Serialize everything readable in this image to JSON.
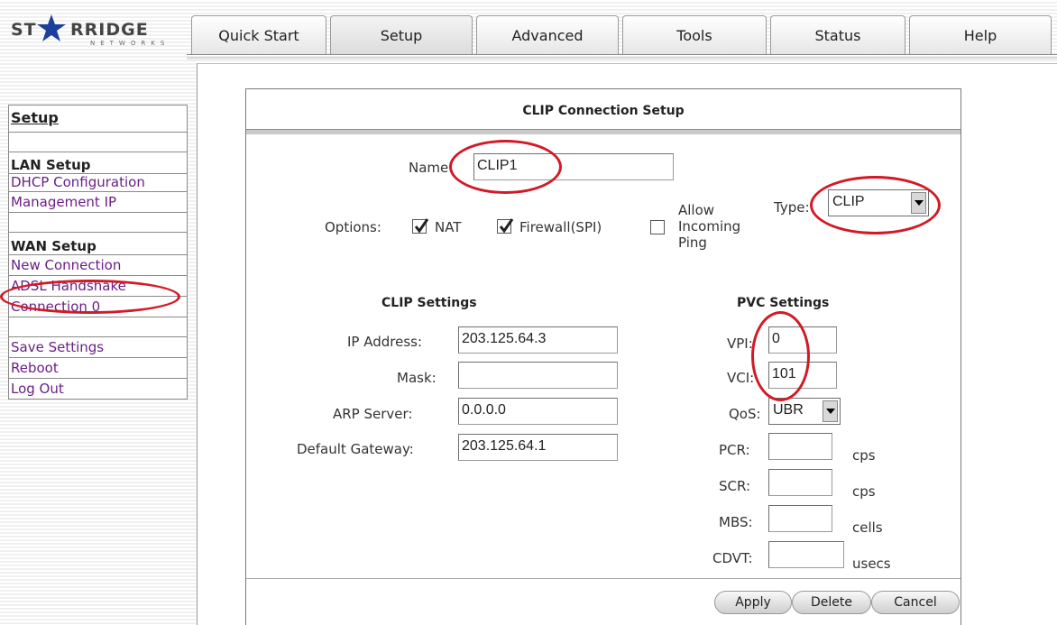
{
  "logo": {
    "left": "ST",
    "right": "RRIDGE",
    "sub": "NETWORKS"
  },
  "tabs": [
    "Quick Start",
    "Setup",
    "Advanced",
    "Tools",
    "Status",
    "Help"
  ],
  "active_tab": "Setup",
  "sidebar": {
    "title": "Setup",
    "lan_section": "LAN Setup",
    "lan_items": [
      "DHCP Configuration",
      "Management IP"
    ],
    "wan_section": "WAN Setup",
    "wan_items": [
      "New Connection",
      "ADSL Handshake",
      "Connection 0"
    ],
    "other_items": [
      "Save Settings",
      "Reboot",
      "Log Out"
    ]
  },
  "panel": {
    "title": "CLIP Connection Setup",
    "name_label": "Name:",
    "name_value": "CLIP1",
    "options_label": "Options:",
    "nat_label": "NAT",
    "nat_checked": true,
    "firewall_label": "Firewall(SPI)",
    "firewall_checked": true,
    "ping_label_1": "Allow",
    "ping_label_2": "Incoming",
    "ping_label_3": "Ping",
    "ping_checked": false,
    "type_label": "Type:",
    "type_value": "CLIP"
  },
  "clip_settings": {
    "heading": "CLIP Settings",
    "ip_label": "IP Address:",
    "ip_value": "203.125.64.3",
    "mask_label": "Mask:",
    "mask_value": "",
    "arp_label": "ARP Server:",
    "arp_value": "0.0.0.0",
    "gateway_label": "Default Gateway:",
    "gateway_value": "203.125.64.1"
  },
  "pvc_settings": {
    "heading": "PVC Settings",
    "vpi_label": "VPI:",
    "vpi_value": "0",
    "vci_label": "VCI:",
    "vci_value": "101",
    "qos_label": "QoS:",
    "qos_value": "UBR",
    "pcr_label": "PCR:",
    "pcr_unit": "cps",
    "scr_label": "SCR:",
    "scr_unit": "cps",
    "mbs_label": "MBS:",
    "mbs_unit": "cells",
    "cdvt_label": "CDVT:",
    "cdvt_unit": "usecs"
  },
  "buttons": {
    "apply": "Apply",
    "delete": "Delete",
    "cancel": "Cancel"
  },
  "annotation_color": "#d21a26"
}
